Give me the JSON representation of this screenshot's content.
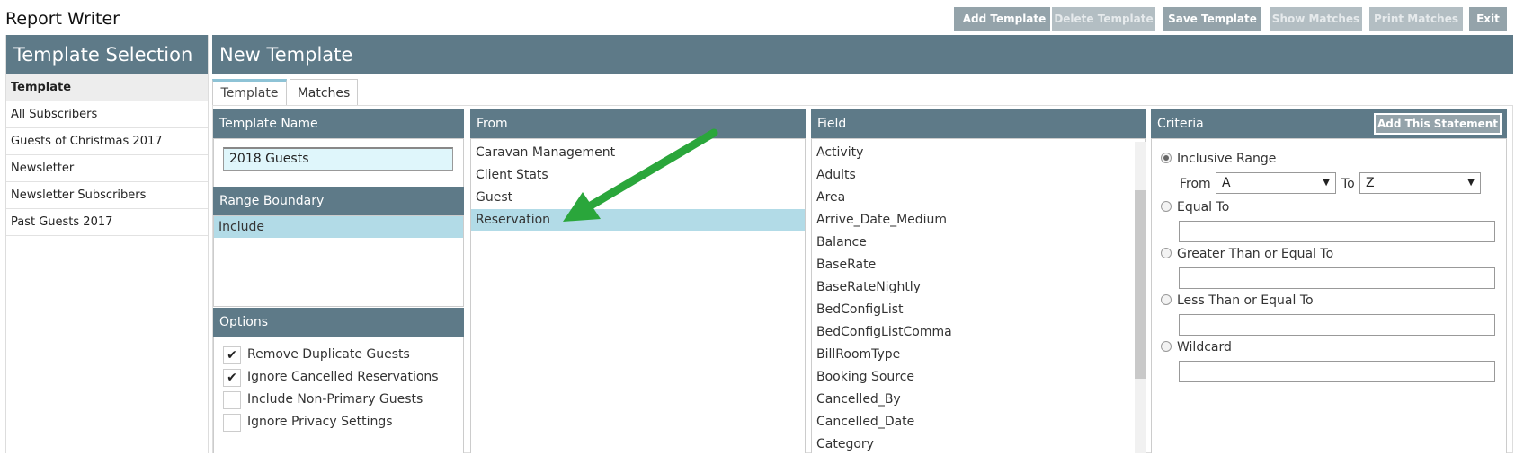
{
  "app": {
    "title": "Report Writer"
  },
  "sidebar": {
    "title": "Template Selection",
    "items": [
      {
        "label": "Template"
      },
      {
        "label": "All Subscribers"
      },
      {
        "label": "Guests of Christmas 2017"
      },
      {
        "label": "Newsletter"
      },
      {
        "label": "Newsletter Subscribers"
      },
      {
        "label": "Past Guests 2017"
      }
    ]
  },
  "header": {
    "title": "New Template",
    "buttons": {
      "add": "Add Template",
      "delete": "Delete Template",
      "save": "Save Template",
      "show_matches": "Show Matches",
      "print_matches": "Print Matches",
      "exit": "Exit"
    }
  },
  "tabs": [
    {
      "label": "Template"
    },
    {
      "label": "Matches"
    }
  ],
  "template_name": {
    "title": "Template Name",
    "value": "2018 Guests"
  },
  "range_boundary": {
    "title": "Range Boundary",
    "items": [
      {
        "label": "Include"
      }
    ]
  },
  "options": {
    "title": "Options",
    "items": [
      {
        "label": "Remove Duplicate Guests",
        "checked": "✔"
      },
      {
        "label": "Ignore Cancelled Reservations",
        "checked": "✔"
      },
      {
        "label": "Include Non-Primary Guests",
        "checked": ""
      },
      {
        "label": "Ignore Privacy Settings",
        "checked": ""
      }
    ]
  },
  "from": {
    "title": "From",
    "items": [
      {
        "label": "Caravan Management"
      },
      {
        "label": "Client Stats"
      },
      {
        "label": "Guest"
      },
      {
        "label": "Reservation"
      }
    ]
  },
  "field": {
    "title": "Field",
    "items": [
      {
        "label": "Activity"
      },
      {
        "label": "Adults"
      },
      {
        "label": "Area"
      },
      {
        "label": "Arrive_Date_Medium"
      },
      {
        "label": "Balance"
      },
      {
        "label": "BaseRate"
      },
      {
        "label": "BaseRateNightly"
      },
      {
        "label": "BedConfigList"
      },
      {
        "label": "BedConfigListComma"
      },
      {
        "label": "BillRoomType"
      },
      {
        "label": "Booking Source"
      },
      {
        "label": "Cancelled_By"
      },
      {
        "label": "Cancelled_Date"
      },
      {
        "label": "Category"
      }
    ]
  },
  "criteria": {
    "title": "Criteria",
    "add_button": "Add This Statement",
    "inclusive": "Inclusive Range",
    "from_label": "From",
    "from_value": "A",
    "to_label": "To",
    "to_value": "Z",
    "equal": "Equal To",
    "gte": "Greater Than or Equal To",
    "lte": "Less Than or Equal To",
    "wildcard": "Wildcard"
  },
  "colors": {
    "header": "#5e7a88",
    "selected_row": "#b2dbe7",
    "annotation_arrow": "#2aa63b"
  }
}
